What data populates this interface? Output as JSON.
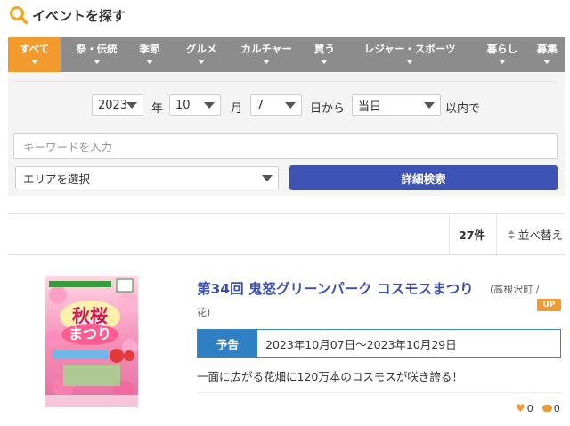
{
  "header": {
    "title": "イベントを探す",
    "icon": "search-icon"
  },
  "categories": [
    {
      "label": "すべて",
      "active": true
    },
    {
      "label": "祭・伝統",
      "active": false
    },
    {
      "label": "季節",
      "active": false
    },
    {
      "label": "グルメ",
      "active": false
    },
    {
      "label": "カルチャー",
      "active": false
    },
    {
      "label": "買う",
      "active": false
    },
    {
      "label": "レジャー・スポーツ",
      "active": false
    },
    {
      "label": "暮らし",
      "active": false
    },
    {
      "label": "募集",
      "active": false
    }
  ],
  "search": {
    "year": "2023",
    "year_label": "年",
    "month": "10",
    "month_label": "月",
    "day": "7",
    "day_label": "日から",
    "range": "当日",
    "range_label": "以内で",
    "keyword_placeholder": "キーワードを入力",
    "area_placeholder": "エリアを選択",
    "detail_button": "詳細検索"
  },
  "results": {
    "count": "27件",
    "sort_label": "並べ替え"
  },
  "event": {
    "title": "第34回 鬼怒グリーンパーク コスモスまつり",
    "area_line1": "(高根沢町 /",
    "area_line2": "花)",
    "badge": "UP",
    "period_tag": "予告",
    "period": "2023年10月07日～2023年10月29日",
    "description": "一面に広がる花畑に120万本のコスモスが咲き誇る！",
    "likes": "0",
    "comments": "0",
    "poster": {
      "main_text_1": "秋桜",
      "main_text_2": "まつり"
    }
  },
  "colors": {
    "accent_orange": "#f39a2e",
    "category_gray": "#8c8c8c",
    "button_blue": "#3f53b5",
    "title_blue": "#3a4fae",
    "period_blue": "#2f7fc4"
  }
}
